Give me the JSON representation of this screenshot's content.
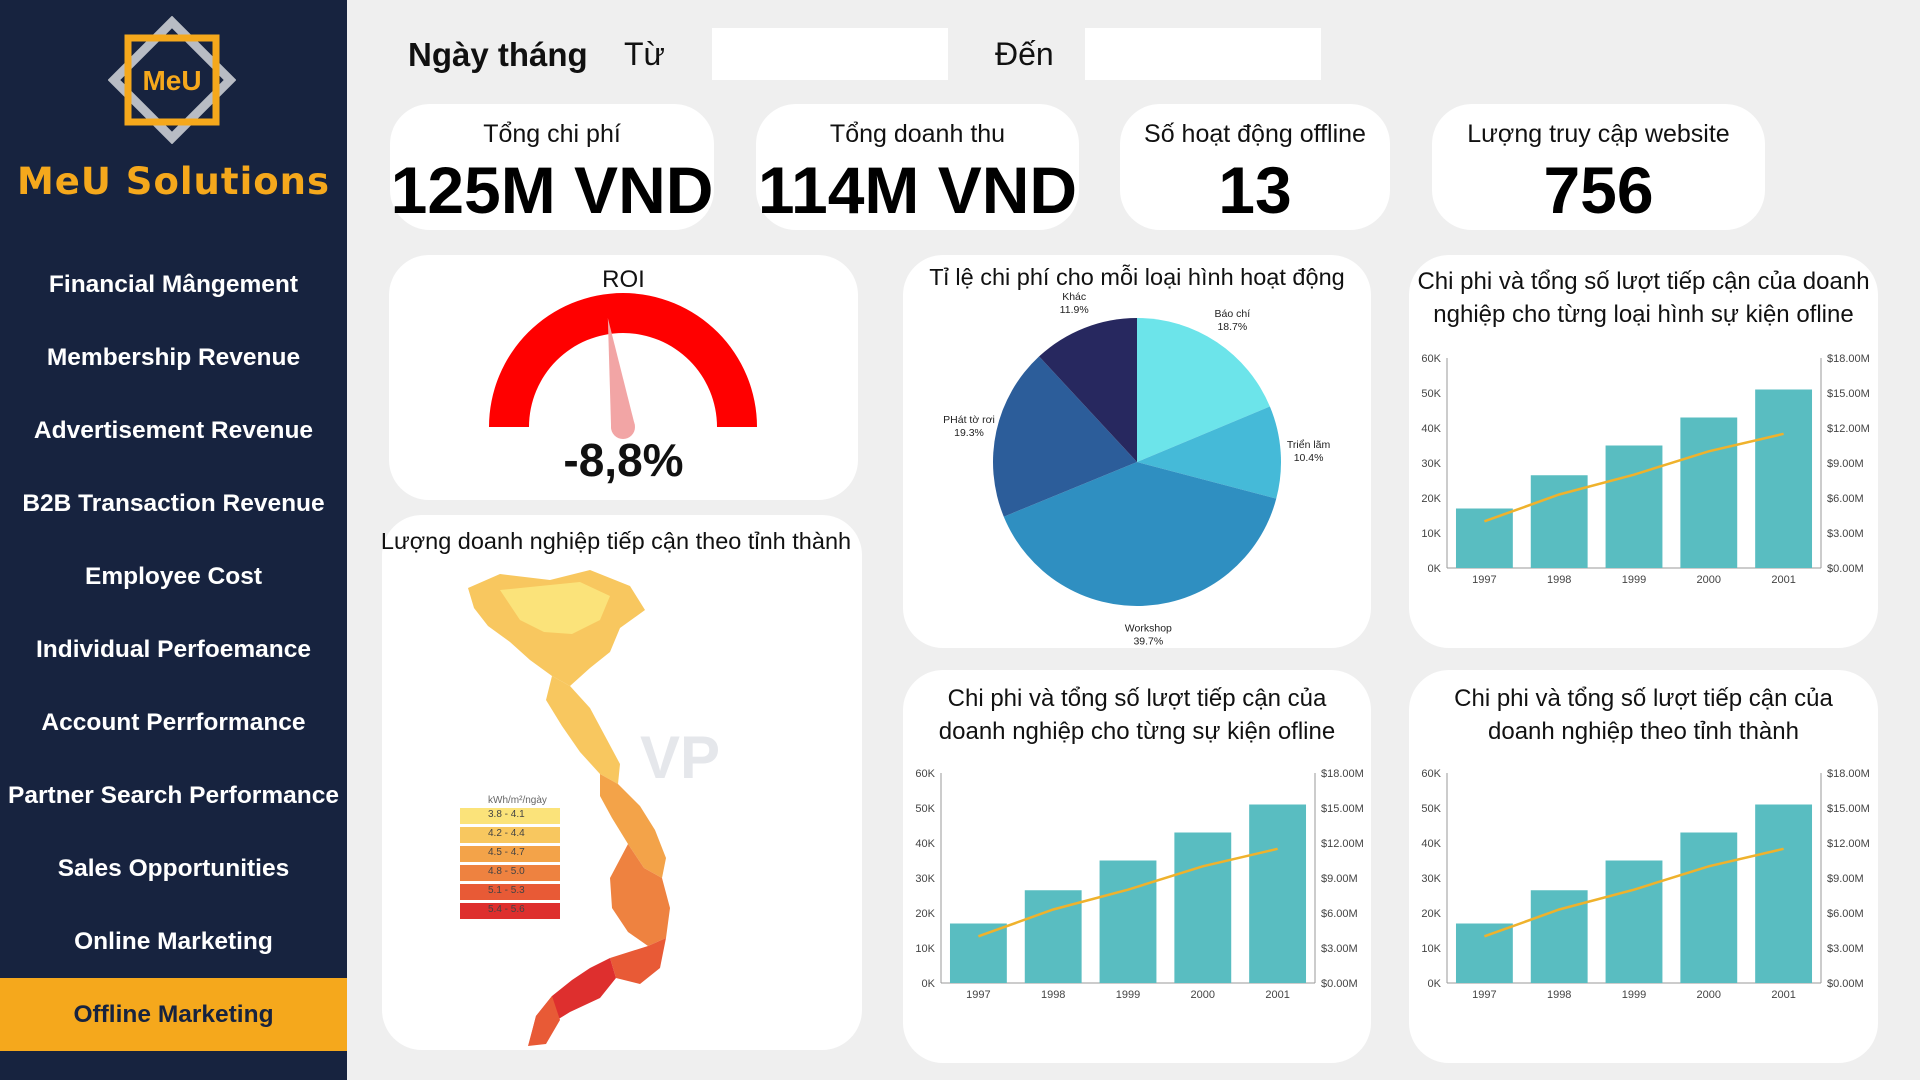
{
  "brand": {
    "logo_text": "MeU",
    "name": "MeU Solutions"
  },
  "nav": [
    "Financial Mângement",
    "Membership Revenue",
    "Advertisement Revenue",
    "B2B Transaction Revenue",
    "Employee Cost",
    "Individual Perfoemance",
    "Account Perrformance",
    "Partner Search Performance",
    "Sales Opportunities",
    "Online Marketing",
    "Offline Marketing"
  ],
  "active_nav": "Offline Marketing",
  "filters": {
    "date_label": "Ngày tháng",
    "from_label": "Từ",
    "to_label": "Đến",
    "from_value": "",
    "to_value": ""
  },
  "kpis": [
    {
      "label": "Tổng chi phí",
      "value": "125M VND"
    },
    {
      "label": "Tổng doanh thu",
      "value": "114M VND"
    },
    {
      "label": "Số hoạt động offline",
      "value": "13"
    },
    {
      "label": "Lượng truy cập website",
      "value": "756"
    }
  ],
  "roi": {
    "title": "ROI",
    "value_text": "-8,8%",
    "value": -8.8,
    "gauge_color": "#ff0000"
  },
  "map": {
    "title": "Lượng doanh nghiệp tiếp cận theo tỉnh thành",
    "legend_unit": "kWh/m²/ngày",
    "legend": [
      {
        "label": "3.8 - 4.1",
        "color": "#fbe37a"
      },
      {
        "label": "4.2 - 4.4",
        "color": "#f8c75f"
      },
      {
        "label": "4.5 - 4.7",
        "color": "#f3a349"
      },
      {
        "label": "4.8 - 5.0",
        "color": "#ee8240"
      },
      {
        "label": "5.1 - 5.3",
        "color": "#e85a36"
      },
      {
        "label": "5.4 - 5.6",
        "color": "#de2f2e"
      }
    ]
  },
  "colors": {
    "sidebar": "#17233f",
    "accent": "#f5a81c",
    "bar": "#59bdc1",
    "line": "#efb22c"
  },
  "chart_data": [
    {
      "type": "pie",
      "title": "Tỉ lệ chi phí cho mỗi loại hình hoạt động",
      "slices": [
        {
          "label": "Báo chí",
          "value": 18.7,
          "pct_text": "18.7%",
          "color": "#6ce4ea"
        },
        {
          "label": "Triển lãm",
          "value": 10.4,
          "pct_text": "10.4%",
          "color": "#45bad8"
        },
        {
          "label": "Workshop",
          "value": 39.7,
          "pct_text": "39.7%",
          "color": "#2f8fc1"
        },
        {
          "label": "PHát tờ rơi",
          "value": 19.3,
          "pct_text": "19.3%",
          "color": "#2c5d9a"
        },
        {
          "label": "Khác",
          "value": 11.9,
          "pct_text": "11.9%",
          "color": "#27285f"
        }
      ]
    },
    {
      "type": "bar",
      "title": "Chi phi và tổng số lượt tiếp cận của doanh nghiệp cho từng loại hình sự kiện ofline",
      "categories": [
        "1997",
        "1998",
        "1999",
        "2000",
        "2001"
      ],
      "bars": [
        17,
        26.5,
        35,
        43,
        51
      ],
      "line": [
        4,
        6.3,
        8,
        10,
        11.5
      ],
      "y_ticks": [
        "0K",
        "10K",
        "20K",
        "30K",
        "40K",
        "50K",
        "60K"
      ],
      "y2_ticks": [
        "$0.00M",
        "$3.00M",
        "$6.00M",
        "$9.00M",
        "$12.00M",
        "$15.00M",
        "$18.00M"
      ],
      "ylim": [
        0,
        60
      ],
      "y2lim": [
        0,
        18
      ]
    },
    {
      "type": "bar",
      "title": "Chi phi và tổng số lượt tiếp cận của doanh nghiệp cho từng sự kiện ofline",
      "categories": [
        "1997",
        "1998",
        "1999",
        "2000",
        "2001"
      ],
      "bars": [
        17,
        26.5,
        35,
        43,
        51
      ],
      "line": [
        4,
        6.3,
        8,
        10,
        11.5
      ],
      "y_ticks": [
        "0K",
        "10K",
        "20K",
        "30K",
        "40K",
        "50K",
        "60K"
      ],
      "y2_ticks": [
        "$0.00M",
        "$3.00M",
        "$6.00M",
        "$9.00M",
        "$12.00M",
        "$15.00M",
        "$18.00M"
      ],
      "ylim": [
        0,
        60
      ],
      "y2lim": [
        0,
        18
      ]
    },
    {
      "type": "bar",
      "title": "Chi phi và tổng số lượt tiếp cận của doanh nghiệp theo tỉnh thành",
      "categories": [
        "1997",
        "1998",
        "1999",
        "2000",
        "2001"
      ],
      "bars": [
        17,
        26.5,
        35,
        43,
        51
      ],
      "line": [
        4,
        6.3,
        8,
        10,
        11.5
      ],
      "y_ticks": [
        "0K",
        "10K",
        "20K",
        "30K",
        "40K",
        "50K",
        "60K"
      ],
      "y2_ticks": [
        "$0.00M",
        "$3.00M",
        "$6.00M",
        "$9.00M",
        "$12.00M",
        "$15.00M",
        "$18.00M"
      ],
      "ylim": [
        0,
        60
      ],
      "y2lim": [
        0,
        18
      ]
    }
  ]
}
